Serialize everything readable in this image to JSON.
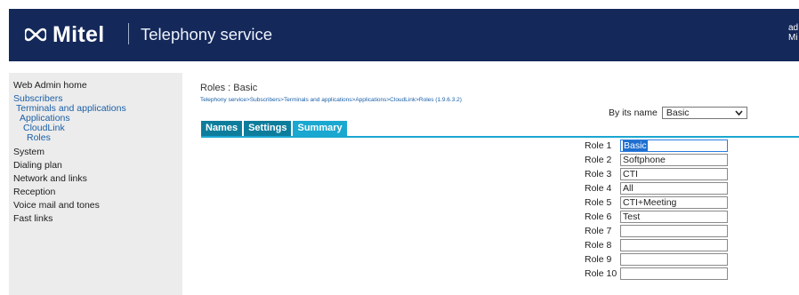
{
  "header": {
    "brand": "Mitel",
    "title": "Telephony service",
    "user_line1": "ad",
    "user_line2": "Mi",
    "bg_color": "#14285a"
  },
  "sidebar": {
    "items": [
      {
        "label": "Web Admin home"
      },
      {
        "label": "Subscribers"
      },
      {
        "label": "Terminals and applications"
      },
      {
        "label": "Applications"
      },
      {
        "label": "CloudLink"
      },
      {
        "label": "Roles"
      },
      {
        "label": "System"
      },
      {
        "label": "Dialing plan"
      },
      {
        "label": "Network and links"
      },
      {
        "label": "Reception"
      },
      {
        "label": "Voice mail and tones"
      },
      {
        "label": "Fast links"
      }
    ]
  },
  "main": {
    "title": "Roles : Basic",
    "breadcrumb": "Telephony service>Subscribers>Terminals and applications>Applications>CloudLink>Roles (1.9.6.3.2)",
    "filter": {
      "label": "By its name",
      "selected": "Basic"
    },
    "tabs": [
      {
        "label": "Names"
      },
      {
        "label": "Settings"
      },
      {
        "label": "Summary"
      }
    ],
    "active_tab": "Summary",
    "accent_color": "#1aa7d0",
    "roles": [
      {
        "label": "Role 1",
        "value": "Basic"
      },
      {
        "label": "Role 2",
        "value": "Softphone"
      },
      {
        "label": "Role 3",
        "value": "CTI"
      },
      {
        "label": "Role 4",
        "value": "All"
      },
      {
        "label": "Role 5",
        "value": "CTI+Meeting"
      },
      {
        "label": "Role 6",
        "value": "Test"
      },
      {
        "label": "Role 7",
        "value": ""
      },
      {
        "label": "Role 8",
        "value": ""
      },
      {
        "label": "Role 9",
        "value": ""
      },
      {
        "label": "Role 10",
        "value": ""
      }
    ]
  }
}
